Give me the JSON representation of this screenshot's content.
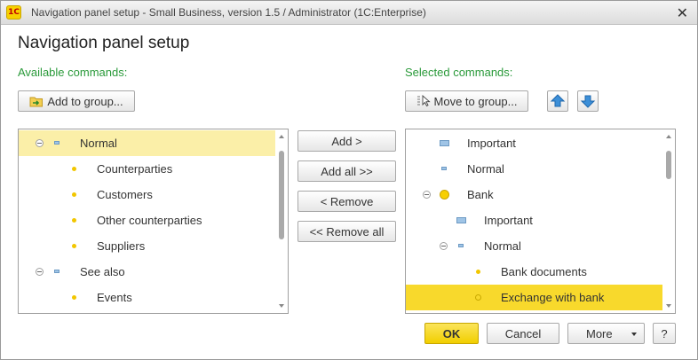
{
  "window": {
    "title": "Navigation panel setup - Small Business, version 1.5 / Administrator  (1C:Enterprise)",
    "logo_text": "1C",
    "close_symbol": "✕"
  },
  "dialog": {
    "title": "Navigation panel setup"
  },
  "available": {
    "label": "Available commands:",
    "add_to_group_label": "Add to group...",
    "items": [
      {
        "label": "Normal",
        "icon": "rect-small-icon",
        "expander": true
      },
      {
        "label": "Counterparties",
        "icon": "dot-icon"
      },
      {
        "label": "Customers",
        "icon": "dot-icon"
      },
      {
        "label": "Other counterparties",
        "icon": "dot-icon"
      },
      {
        "label": "Suppliers",
        "icon": "dot-icon"
      },
      {
        "label": "See also",
        "icon": "rect-small-icon",
        "expander": true
      },
      {
        "label": "Events",
        "icon": "dot-icon"
      }
    ]
  },
  "middle": {
    "add_label": "Add >",
    "add_all_label": "Add all >>",
    "remove_label": "< Remove",
    "remove_all_label": "<< Remove all"
  },
  "selected": {
    "label": "Selected commands:",
    "move_to_group_label": "Move to group...",
    "items": [
      {
        "label": "Important",
        "icon": "rect-big-icon"
      },
      {
        "label": "Normal",
        "icon": "rect-small-icon"
      },
      {
        "label": "Bank",
        "icon": "dot-big-icon",
        "expander": true
      },
      {
        "label": "Important",
        "icon": "rect-big-icon"
      },
      {
        "label": "Normal",
        "icon": "rect-small-icon",
        "expander": true
      },
      {
        "label": "Bank documents",
        "icon": "dot-icon"
      },
      {
        "label": "Exchange with bank",
        "icon": "dot-ring-icon"
      }
    ]
  },
  "footer": {
    "ok_label": "OK",
    "cancel_label": "Cancel",
    "more_label": "More",
    "help_label": "?"
  },
  "colors": {
    "section_label": "#2a9a3a",
    "selection_light": "#fbefa8",
    "selection_strong": "#f8d92c",
    "ok_button": "#f1cf00",
    "arrow_blue": "#3c8fd8"
  }
}
